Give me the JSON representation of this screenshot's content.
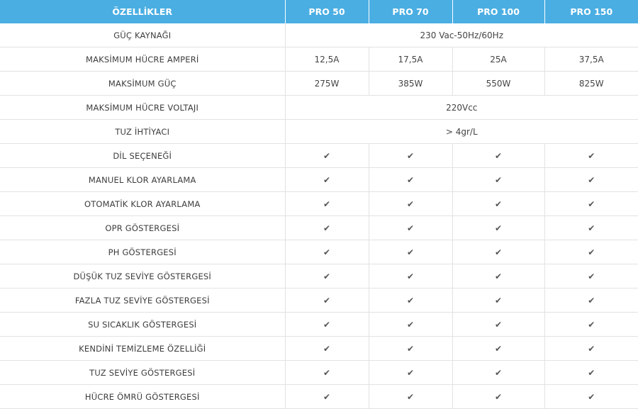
{
  "header": {
    "features": "ÖZELLİKLER",
    "models": [
      "PRO 50",
      "PRO 70",
      "PRO 100",
      "PRO 150"
    ]
  },
  "check_icon": "checkmark-icon",
  "colors": {
    "header_bg": "#4aaee2",
    "header_text": "#ffffff",
    "grid": "#e2e2e2"
  },
  "rows": [
    {
      "feature": "GÜÇ KAYNAĞI",
      "span": "230 Vac-50Hz/60Hz"
    },
    {
      "feature": "MAKSİMUM HÜCRE AMPERİ",
      "values": [
        "12,5A",
        "17,5A",
        "25A",
        "37,5A"
      ]
    },
    {
      "feature": "MAKSİMUM GÜÇ",
      "values": [
        "275W",
        "385W",
        "550W",
        "825W"
      ]
    },
    {
      "feature": "MAKSİMUM HÜCRE VOLTAJI",
      "span": "220Vcc"
    },
    {
      "feature": "TUZ İHTİYACI",
      "span": "> 4gr/L"
    },
    {
      "feature": "DİL SEÇENEĞİ",
      "check": true
    },
    {
      "feature": "MANUEL KLOR AYARLAMA",
      "check": true
    },
    {
      "feature": "OTOMATİK KLOR AYARLAMA",
      "check": true
    },
    {
      "feature": "OPR GÖSTERGESİ",
      "check": true
    },
    {
      "feature": "PH GÖSTERGESİ",
      "check": true
    },
    {
      "feature": "DÜŞÜK TUZ SEVİYE GÖSTERGESİ",
      "check": true
    },
    {
      "feature": "FAZLA TUZ SEVİYE GÖSTERGESİ",
      "check": true
    },
    {
      "feature": "SU SICAKLIK GÖSTERGESİ",
      "check": true
    },
    {
      "feature": "KENDİNİ TEMİZLEME ÖZELLİĞİ",
      "check": true
    },
    {
      "feature": "TUZ SEVİYE GÖSTERGESİ",
      "check": true
    },
    {
      "feature": "HÜCRE ÖMRÜ GÖSTERGESİ",
      "check": true
    }
  ]
}
